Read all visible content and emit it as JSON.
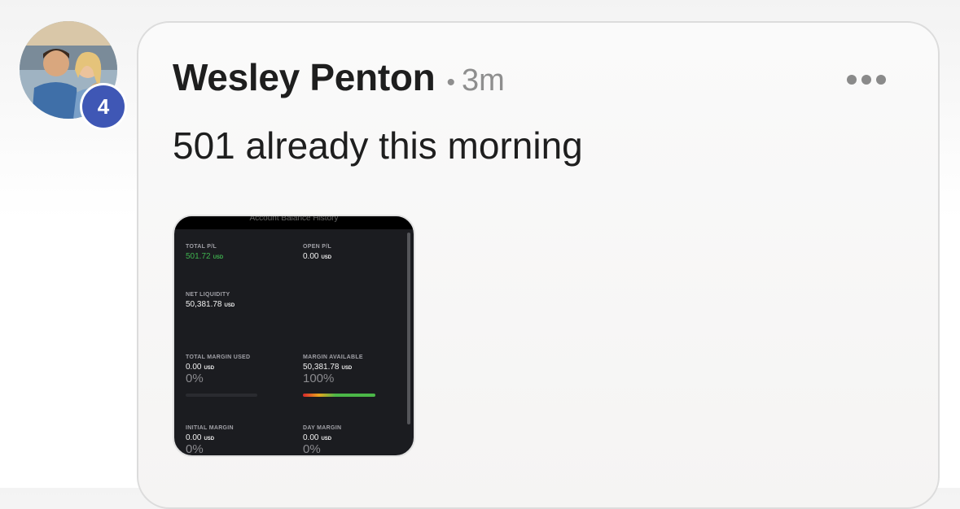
{
  "post": {
    "author": "Wesley Penton",
    "separator": "•",
    "time": "3m",
    "message": "501 already this morning",
    "avatar_badge": "4",
    "more_icon": "more-horizontal-icon"
  },
  "attachment": {
    "header": "Account Balance History",
    "total_pl": {
      "label": "TOTAL P/L",
      "value": "501.72",
      "unit": "USD"
    },
    "open_pl": {
      "label": "OPEN P/L",
      "value": "0.00",
      "unit": "USD"
    },
    "net_liquidity": {
      "label": "NET LIQUIDITY",
      "value": "50,381.78",
      "unit": "USD"
    },
    "total_margin_used": {
      "label": "TOTAL MARGIN USED",
      "value": "0.00",
      "unit": "USD",
      "percent": "0%"
    },
    "margin_available": {
      "label": "MARGIN AVAILABLE",
      "value": "50,381.78",
      "unit": "USD",
      "percent": "100%"
    },
    "initial_margin": {
      "label": "INITIAL MARGIN",
      "value": "0.00",
      "unit": "USD",
      "percent": "0%"
    },
    "day_margin": {
      "label": "DAY MARGIN",
      "value": "0.00",
      "unit": "USD",
      "percent": "0%"
    },
    "margin_available_fill": 1.0,
    "margin_used_fill": 0.0
  },
  "colors": {
    "badge": "#3f57b5",
    "positive": "#3fb34f",
    "attachment_bg": "#1b1c20"
  }
}
